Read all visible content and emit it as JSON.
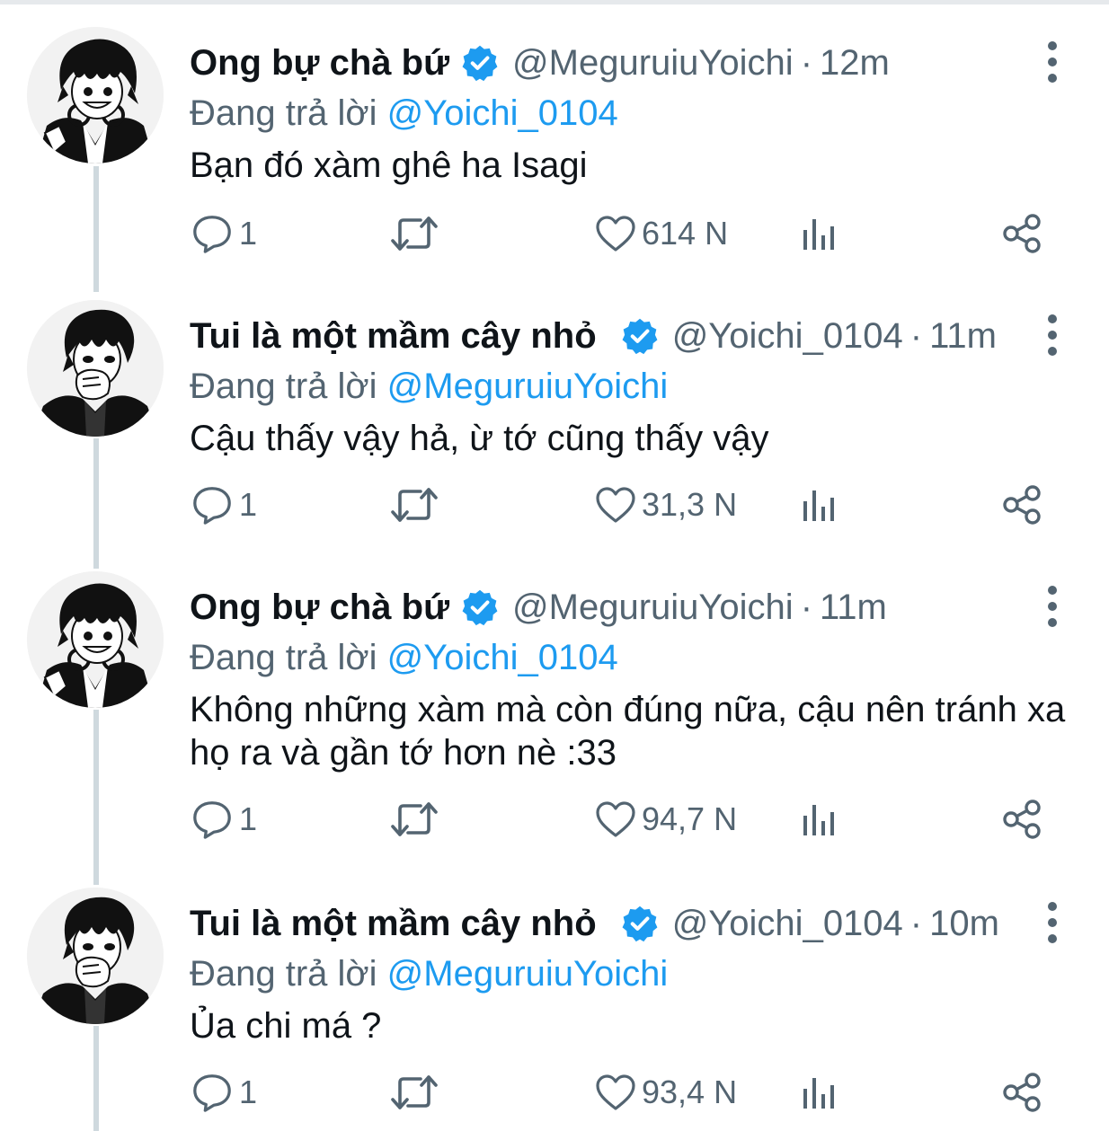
{
  "tweets": [
    {
      "name": "Ong bự chà bứ",
      "handle": "@MeguruiuYoichi",
      "time": "12m",
      "reply_prefix": "Đang trả lời",
      "reply_mention": "@Yoichi_0104",
      "text": "Bạn đó xàm ghê ha Isagi",
      "replies": "1",
      "likes": "614 N",
      "avatar": "avatar-meguru"
    },
    {
      "name": "Tui là một mầm cây nhỏ",
      "handle": "@Yoichi_0104",
      "time": "11m",
      "reply_prefix": "Đang trả lời",
      "reply_mention": "@MeguruiuYoichi",
      "text": "Cậu thấy vậy hả, ừ tớ cũng thấy vậy",
      "replies": "1",
      "likes": "31,3 N",
      "avatar": "avatar-yoichi"
    },
    {
      "name": "Ong bự chà bứ",
      "handle": "@MeguruiuYoichi",
      "time": "11m",
      "reply_prefix": "Đang trả lời",
      "reply_mention": "@Yoichi_0104",
      "text": "Không những xàm mà còn đúng nữa, cậu nên tránh xa họ ra và gần tớ hơn nè :33",
      "replies": "1",
      "likes": "94,7 N",
      "avatar": "avatar-meguru"
    },
    {
      "name": "Tui là một mầm cây nhỏ",
      "handle": "@Yoichi_0104",
      "time": "10m",
      "reply_prefix": "Đang trả lời",
      "reply_mention": "@MeguruiuYoichi",
      "text": "Ủa chi má ?",
      "replies": "1",
      "likes": "93,4 N",
      "avatar": "avatar-yoichi"
    }
  ],
  "separator": "·",
  "icons": {
    "verified": "verified-badge-icon",
    "more": "more-vertical-icon",
    "reply": "reply-bubble-icon",
    "retweet": "retweet-icon",
    "like": "heart-icon",
    "views": "bar-chart-icon",
    "share": "share-icon"
  },
  "colors": {
    "accent": "#1d9bf0",
    "muted": "#536471",
    "text": "#0f1419",
    "thread_line": "#cfd9de"
  }
}
